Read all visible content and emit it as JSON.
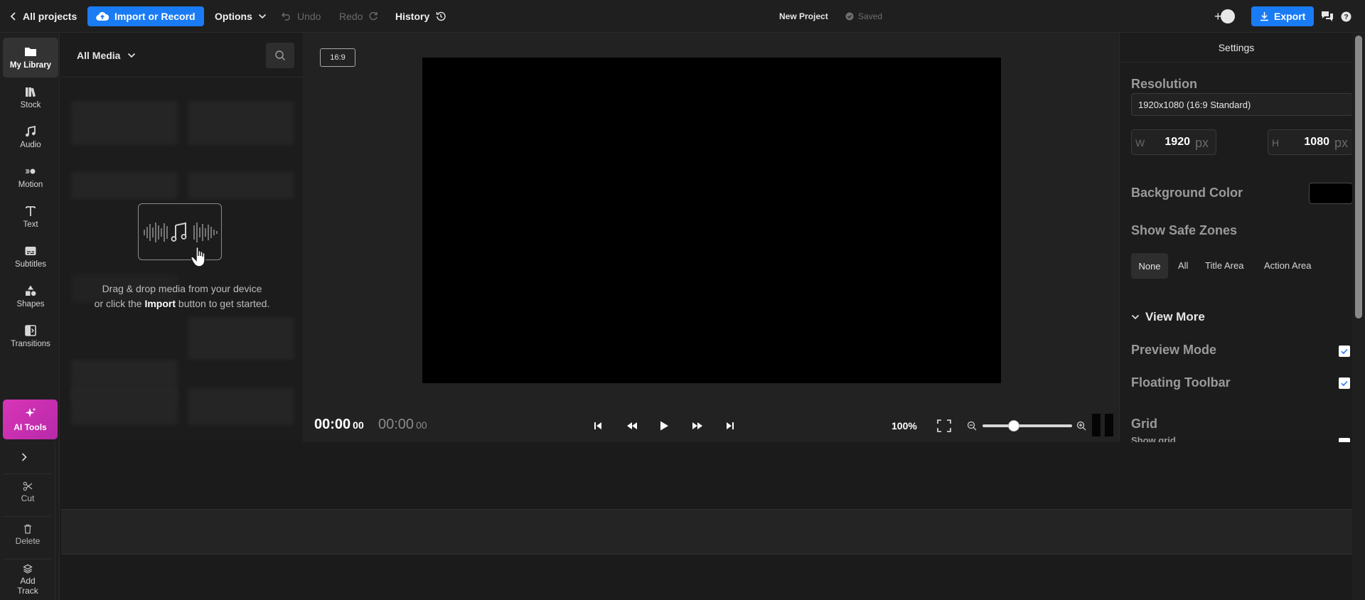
{
  "topbar": {
    "all_projects": "All projects",
    "import_record": "Import or Record",
    "options": "Options",
    "undo": "Undo",
    "redo": "Redo",
    "history": "History",
    "project_name": "New Project",
    "saved": "Saved",
    "export": "Export"
  },
  "sidebar": {
    "items": [
      {
        "label": "My Library",
        "icon": "folder-icon"
      },
      {
        "label": "Stock",
        "icon": "books-icon"
      },
      {
        "label": "Audio",
        "icon": "music-note-icon"
      },
      {
        "label": "Motion",
        "icon": "motion-icon"
      },
      {
        "label": "Text",
        "icon": "text-icon"
      },
      {
        "label": "Subtitles",
        "icon": "subtitles-icon"
      },
      {
        "label": "Shapes",
        "icon": "shapes-icon"
      },
      {
        "label": "Transitions",
        "icon": "transitions-icon"
      }
    ],
    "ai_tools": "AI Tools",
    "cut": "Cut",
    "delete": "Delete",
    "add_track": "Add Track"
  },
  "media": {
    "filter": "All Media",
    "drop_line1": "Drag & drop media from your device",
    "drop_line2_pre": "or click the ",
    "drop_line2_bold": "Import",
    "drop_line2_post": " button to get started."
  },
  "preview": {
    "aspect": "16:9",
    "current_time": "00:00",
    "current_frames": "00",
    "total_time": "00:00",
    "total_frames": "00",
    "zoom": "100%",
    "zoom_level": 0.35
  },
  "settings": {
    "title": "Settings",
    "resolution_label": "Resolution",
    "resolution_value": "1920x1080 (16:9 Standard)",
    "width_label": "W",
    "width_value": "1920",
    "height_label": "H",
    "height_value": "1080",
    "unit": "px",
    "background_color_label": "Background Color",
    "background_color": "#000000",
    "safe_zones_label": "Show Safe Zones",
    "safe_zones": [
      "None",
      "All",
      "Title Area",
      "Action Area"
    ],
    "safe_zone_selected": "None",
    "view_more": "View More",
    "preview_mode": "Preview Mode",
    "floating_toolbar": "Floating Toolbar",
    "grid_label": "Grid",
    "show_grid": "Show grid"
  },
  "colors": {
    "accent": "#1a7cf5",
    "ai_tools": "#d935b8"
  }
}
